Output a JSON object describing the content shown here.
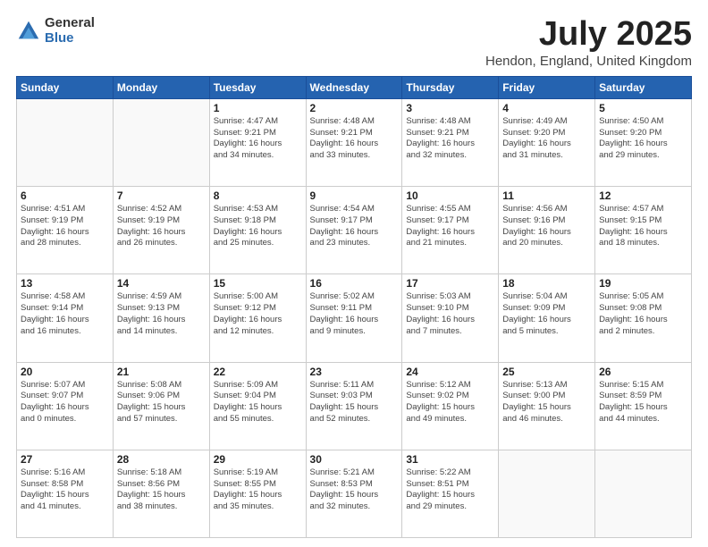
{
  "logo": {
    "general": "General",
    "blue": "Blue"
  },
  "title": "July 2025",
  "location": "Hendon, England, United Kingdom",
  "weekdays": [
    "Sunday",
    "Monday",
    "Tuesday",
    "Wednesday",
    "Thursday",
    "Friday",
    "Saturday"
  ],
  "weeks": [
    [
      {
        "day": "",
        "detail": ""
      },
      {
        "day": "",
        "detail": ""
      },
      {
        "day": "1",
        "detail": "Sunrise: 4:47 AM\nSunset: 9:21 PM\nDaylight: 16 hours\nand 34 minutes."
      },
      {
        "day": "2",
        "detail": "Sunrise: 4:48 AM\nSunset: 9:21 PM\nDaylight: 16 hours\nand 33 minutes."
      },
      {
        "day": "3",
        "detail": "Sunrise: 4:48 AM\nSunset: 9:21 PM\nDaylight: 16 hours\nand 32 minutes."
      },
      {
        "day": "4",
        "detail": "Sunrise: 4:49 AM\nSunset: 9:20 PM\nDaylight: 16 hours\nand 31 minutes."
      },
      {
        "day": "5",
        "detail": "Sunrise: 4:50 AM\nSunset: 9:20 PM\nDaylight: 16 hours\nand 29 minutes."
      }
    ],
    [
      {
        "day": "6",
        "detail": "Sunrise: 4:51 AM\nSunset: 9:19 PM\nDaylight: 16 hours\nand 28 minutes."
      },
      {
        "day": "7",
        "detail": "Sunrise: 4:52 AM\nSunset: 9:19 PM\nDaylight: 16 hours\nand 26 minutes."
      },
      {
        "day": "8",
        "detail": "Sunrise: 4:53 AM\nSunset: 9:18 PM\nDaylight: 16 hours\nand 25 minutes."
      },
      {
        "day": "9",
        "detail": "Sunrise: 4:54 AM\nSunset: 9:17 PM\nDaylight: 16 hours\nand 23 minutes."
      },
      {
        "day": "10",
        "detail": "Sunrise: 4:55 AM\nSunset: 9:17 PM\nDaylight: 16 hours\nand 21 minutes."
      },
      {
        "day": "11",
        "detail": "Sunrise: 4:56 AM\nSunset: 9:16 PM\nDaylight: 16 hours\nand 20 minutes."
      },
      {
        "day": "12",
        "detail": "Sunrise: 4:57 AM\nSunset: 9:15 PM\nDaylight: 16 hours\nand 18 minutes."
      }
    ],
    [
      {
        "day": "13",
        "detail": "Sunrise: 4:58 AM\nSunset: 9:14 PM\nDaylight: 16 hours\nand 16 minutes."
      },
      {
        "day": "14",
        "detail": "Sunrise: 4:59 AM\nSunset: 9:13 PM\nDaylight: 16 hours\nand 14 minutes."
      },
      {
        "day": "15",
        "detail": "Sunrise: 5:00 AM\nSunset: 9:12 PM\nDaylight: 16 hours\nand 12 minutes."
      },
      {
        "day": "16",
        "detail": "Sunrise: 5:02 AM\nSunset: 9:11 PM\nDaylight: 16 hours\nand 9 minutes."
      },
      {
        "day": "17",
        "detail": "Sunrise: 5:03 AM\nSunset: 9:10 PM\nDaylight: 16 hours\nand 7 minutes."
      },
      {
        "day": "18",
        "detail": "Sunrise: 5:04 AM\nSunset: 9:09 PM\nDaylight: 16 hours\nand 5 minutes."
      },
      {
        "day": "19",
        "detail": "Sunrise: 5:05 AM\nSunset: 9:08 PM\nDaylight: 16 hours\nand 2 minutes."
      }
    ],
    [
      {
        "day": "20",
        "detail": "Sunrise: 5:07 AM\nSunset: 9:07 PM\nDaylight: 16 hours\nand 0 minutes."
      },
      {
        "day": "21",
        "detail": "Sunrise: 5:08 AM\nSunset: 9:06 PM\nDaylight: 15 hours\nand 57 minutes."
      },
      {
        "day": "22",
        "detail": "Sunrise: 5:09 AM\nSunset: 9:04 PM\nDaylight: 15 hours\nand 55 minutes."
      },
      {
        "day": "23",
        "detail": "Sunrise: 5:11 AM\nSunset: 9:03 PM\nDaylight: 15 hours\nand 52 minutes."
      },
      {
        "day": "24",
        "detail": "Sunrise: 5:12 AM\nSunset: 9:02 PM\nDaylight: 15 hours\nand 49 minutes."
      },
      {
        "day": "25",
        "detail": "Sunrise: 5:13 AM\nSunset: 9:00 PM\nDaylight: 15 hours\nand 46 minutes."
      },
      {
        "day": "26",
        "detail": "Sunrise: 5:15 AM\nSunset: 8:59 PM\nDaylight: 15 hours\nand 44 minutes."
      }
    ],
    [
      {
        "day": "27",
        "detail": "Sunrise: 5:16 AM\nSunset: 8:58 PM\nDaylight: 15 hours\nand 41 minutes."
      },
      {
        "day": "28",
        "detail": "Sunrise: 5:18 AM\nSunset: 8:56 PM\nDaylight: 15 hours\nand 38 minutes."
      },
      {
        "day": "29",
        "detail": "Sunrise: 5:19 AM\nSunset: 8:55 PM\nDaylight: 15 hours\nand 35 minutes."
      },
      {
        "day": "30",
        "detail": "Sunrise: 5:21 AM\nSunset: 8:53 PM\nDaylight: 15 hours\nand 32 minutes."
      },
      {
        "day": "31",
        "detail": "Sunrise: 5:22 AM\nSunset: 8:51 PM\nDaylight: 15 hours\nand 29 minutes."
      },
      {
        "day": "",
        "detail": ""
      },
      {
        "day": "",
        "detail": ""
      }
    ]
  ]
}
